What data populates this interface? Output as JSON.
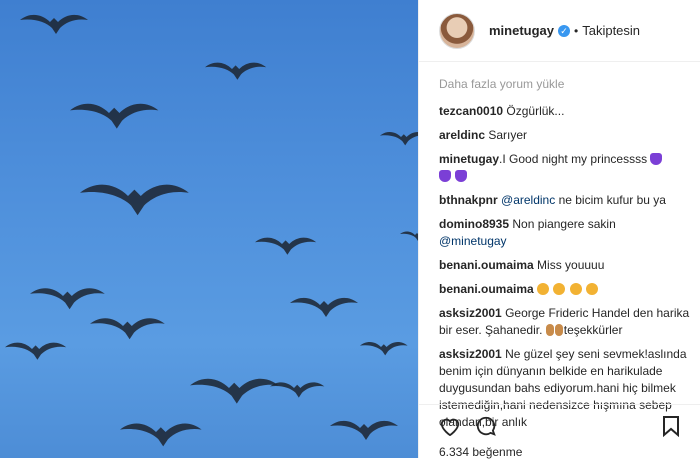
{
  "post": {
    "username": "minetugay",
    "verified_icon": "check-icon",
    "dot": "•",
    "follow_status": "Takiptesin",
    "load_more": "Daha fazla yorum yükle",
    "likes": "6.334 beğenme"
  },
  "comments": [
    {
      "user": "tezcan0010",
      "text": "Özgürlük..."
    },
    {
      "user": "areldinc",
      "text": "Sarıyer"
    },
    {
      "user": "minetugay",
      "text": ".I Good night my princessss"
    },
    {
      "user": "bthnakpnr",
      "mention": "@areldinc",
      "text": " ne bicim kufur bu ya"
    },
    {
      "user": "domino8935",
      "text": "Non piangere sakin",
      "mention2": "@minetugay"
    },
    {
      "user": "benani.oumaima",
      "text": "Miss youuuu"
    },
    {
      "user": "benani.oumaima",
      "text": ""
    },
    {
      "user": "asksiz2001",
      "text": "George Frideric Handel den harika bir eser. Şahanedir.",
      "text2": "teşekkürler"
    },
    {
      "user": "asksiz2001",
      "text": "Ne güzel şey seni sevmek!aslında benim için dünyanın belkide en harikulade duygusundan bahs ediyorum.hani hiç bilmek istemediğin,hani nedensizce hışmına sebep olandan,bir anlık"
    }
  ],
  "colors": {
    "sky": "#4e8fdb",
    "link": "#003569",
    "verified": "#3897f0"
  }
}
